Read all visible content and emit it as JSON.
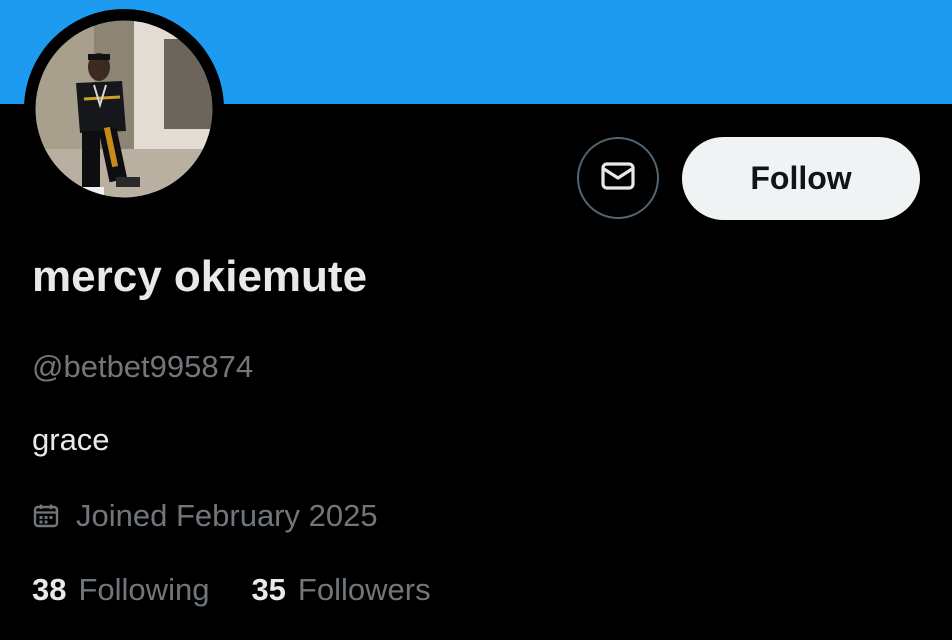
{
  "profile": {
    "display_name": "mercy okiemute",
    "handle": "@betbet995874",
    "bio": "grace",
    "joined": "Joined February 2025",
    "avatar": "profile-photo"
  },
  "actions": {
    "message_icon": "envelope-icon",
    "follow_label": "Follow"
  },
  "stats": {
    "following_count": "38",
    "following_label": "Following",
    "followers_count": "35",
    "followers_label": "Followers"
  },
  "colors": {
    "banner": "#1d9bf0",
    "background": "#000000",
    "primary_text": "#e7e9ea",
    "secondary_text": "#71767b",
    "follow_button_bg": "#eff3f4"
  },
  "icons": {
    "calendar": "calendar-icon"
  }
}
